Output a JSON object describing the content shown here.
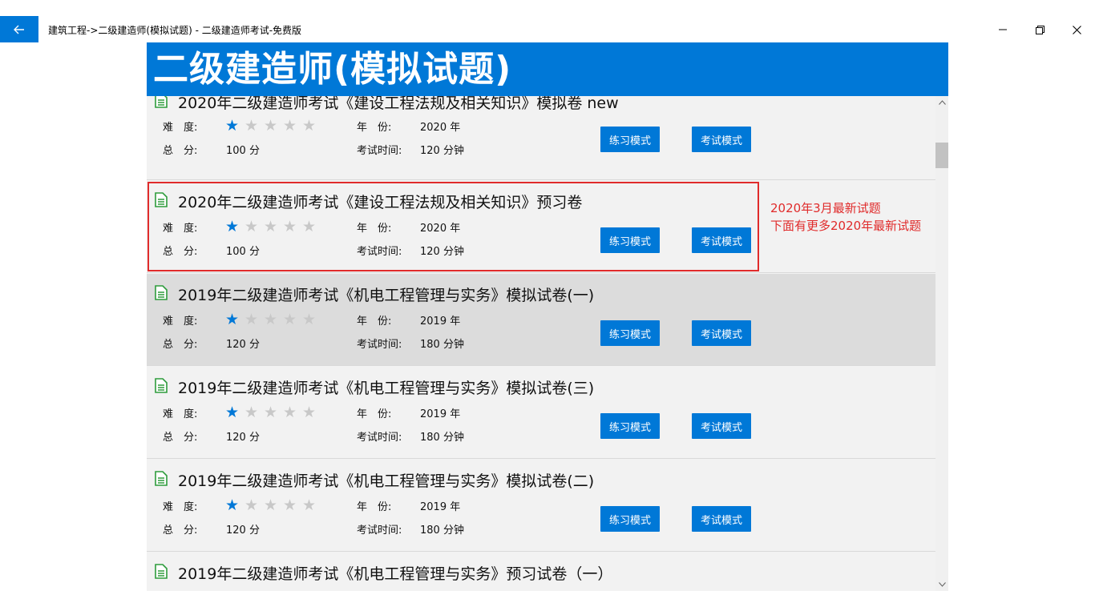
{
  "window": {
    "title": "建筑工程->二级建造师(模拟试题) - 二级建造师考试-免费版"
  },
  "header": {
    "title": "二级建造师(模拟试题)"
  },
  "labels": {
    "difficulty": "难　度:",
    "total": "总　分:",
    "year": "年　份:",
    "duration": "考试时间:"
  },
  "exams": [
    {
      "title": "2020年二级建造师考试《建设工程法规及相关知识》模拟卷 new",
      "difficulty_stars": 1,
      "max_stars": 5,
      "year": "2020 年",
      "score": "100 分",
      "duration": "120 分钟",
      "practice_label": "练习模式",
      "exam_label": "考试模式"
    },
    {
      "title": "2020年二级建造师考试《建设工程法规及相关知识》预习卷",
      "difficulty_stars": 1,
      "max_stars": 5,
      "year": "2020 年",
      "score": "100 分",
      "duration": "120 分钟",
      "practice_label": "练习模式",
      "exam_label": "考试模式"
    },
    {
      "title": "2019年二级建造师考试《机电工程管理与实务》模拟试卷(一)",
      "difficulty_stars": 1,
      "max_stars": 5,
      "year": "2019 年",
      "score": "120 分",
      "duration": "180 分钟",
      "practice_label": "练习模式",
      "exam_label": "考试模式"
    },
    {
      "title": "2019年二级建造师考试《机电工程管理与实务》模拟试卷(三)",
      "difficulty_stars": 1,
      "max_stars": 5,
      "year": "2019 年",
      "score": "120 分",
      "duration": "180 分钟",
      "practice_label": "练习模式",
      "exam_label": "考试模式"
    },
    {
      "title": "2019年二级建造师考试《机电工程管理与实务》模拟试卷(二)",
      "difficulty_stars": 1,
      "max_stars": 5,
      "year": "2019 年",
      "score": "120 分",
      "duration": "180 分钟",
      "practice_label": "练习模式",
      "exam_label": "考试模式"
    },
    {
      "title": "2019年二级建造师考试《机电工程管理与实务》预习试卷（一）"
    }
  ],
  "annotation": {
    "line1": "2020年3月最新试题",
    "line2": "下面有更多2020年最新试题"
  },
  "colors": {
    "accent": "#0078d7",
    "highlight": "#e02b2b",
    "icon": "#2e9c3c"
  }
}
